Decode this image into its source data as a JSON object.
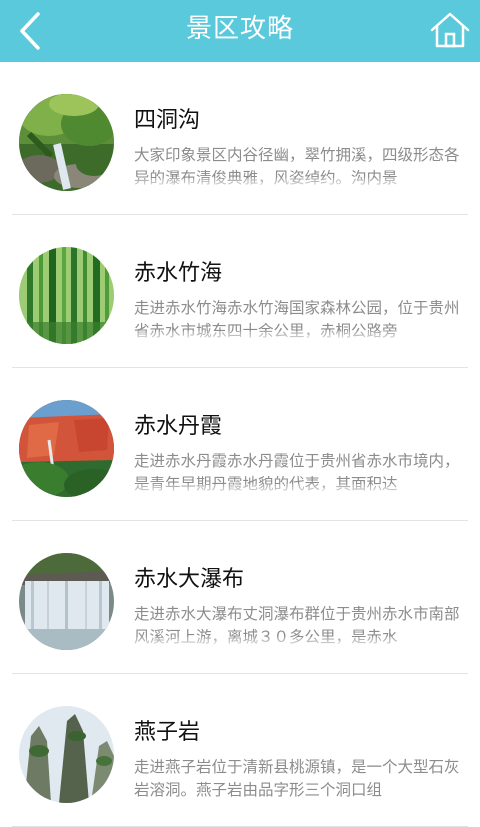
{
  "header": {
    "title": "景区攻略"
  },
  "items": [
    {
      "title": "四洞沟",
      "desc": "大家印象景区内谷径幽，翠竹拥溪，四级形态各异的瀑布清俊典雅，风姿绰约。沟内景"
    },
    {
      "title": "赤水竹海",
      "desc": "走进赤水竹海赤水竹海国家森林公园，位于贵州省赤水市城东四十余公里，赤桐公路旁"
    },
    {
      "title": "赤水丹霞",
      "desc": "走进赤水丹霞赤水丹霞位于贵州省赤水市境内，是青年早期丹霞地貌的代表，其面积达"
    },
    {
      "title": "赤水大瀑布",
      "desc": "走进赤水大瀑布丈洞瀑布群位于贵州赤水市南部风溪河上游，离城３０多公里，是赤水"
    },
    {
      "title": "燕子岩",
      "desc": "走进燕子岩位于清新县桃源镇，是一个大型石灰岩溶洞。燕子岩由品字形三个洞口组"
    }
  ]
}
